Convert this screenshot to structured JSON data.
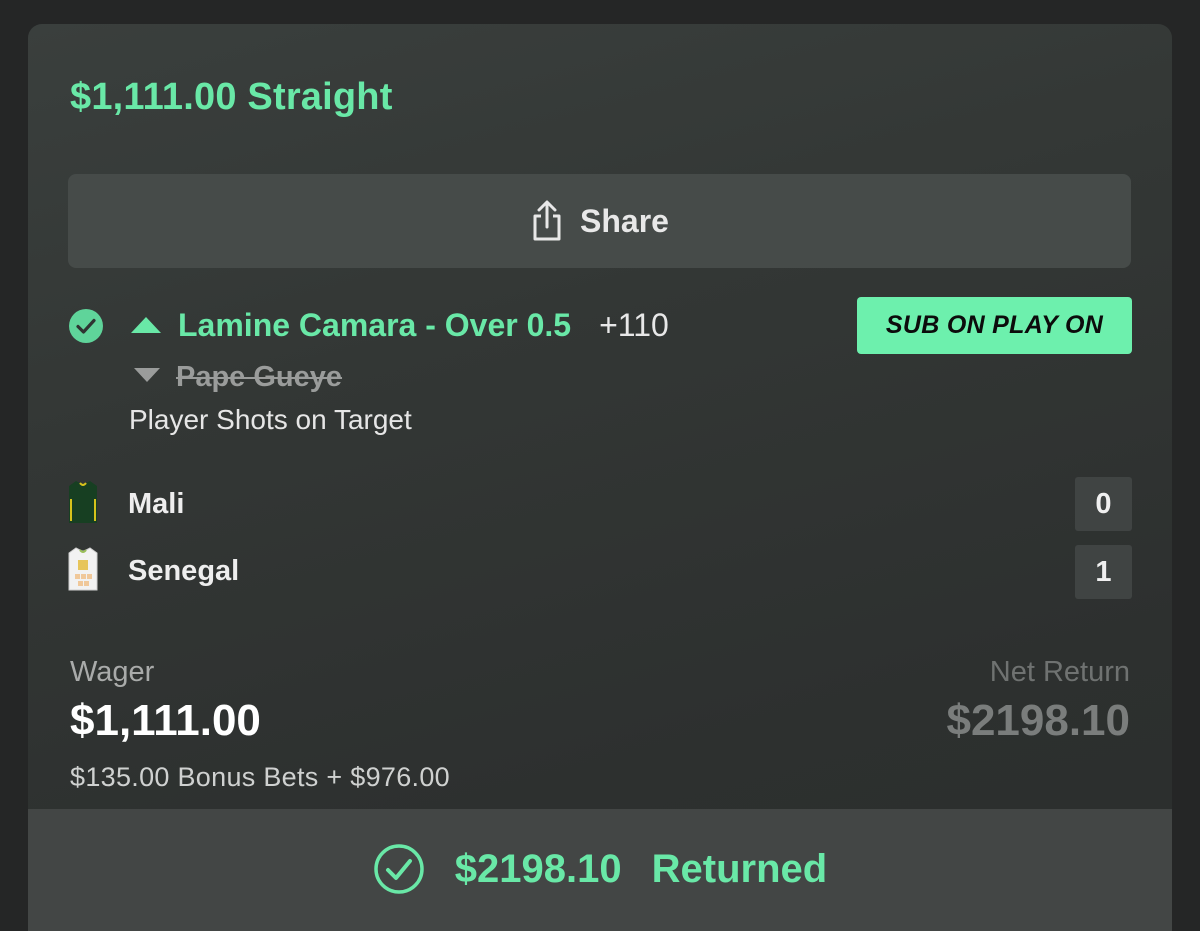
{
  "bet": {
    "title": "$1,111.00 Straight"
  },
  "share": {
    "label": "Share",
    "icon": "share-icon"
  },
  "selection": {
    "status_icon": "check-circle-icon",
    "player_on": "Lamine Camara - Over 0.5",
    "odds": "+110",
    "player_off": "Pape Gueye",
    "market": "Player Shots on Target",
    "badge": "SUB ON PLAY ON"
  },
  "teams": [
    {
      "name": "Mali",
      "score": "0",
      "icon": "jersey-icon"
    },
    {
      "name": "Senegal",
      "score": "1",
      "icon": "jersey-icon"
    }
  ],
  "wager": {
    "label": "Wager",
    "amount": "$1,111.00",
    "detail": "$135.00 Bonus Bets + $976.00"
  },
  "net_return": {
    "label": "Net Return",
    "amount": "$2198.10"
  },
  "result": {
    "amount": "$2198.10",
    "status": "Returned"
  },
  "colors": {
    "accent": "#69e8a7",
    "badge_bg": "#6df0ad",
    "card_bg": "#333735",
    "page_bg": "#252626"
  }
}
